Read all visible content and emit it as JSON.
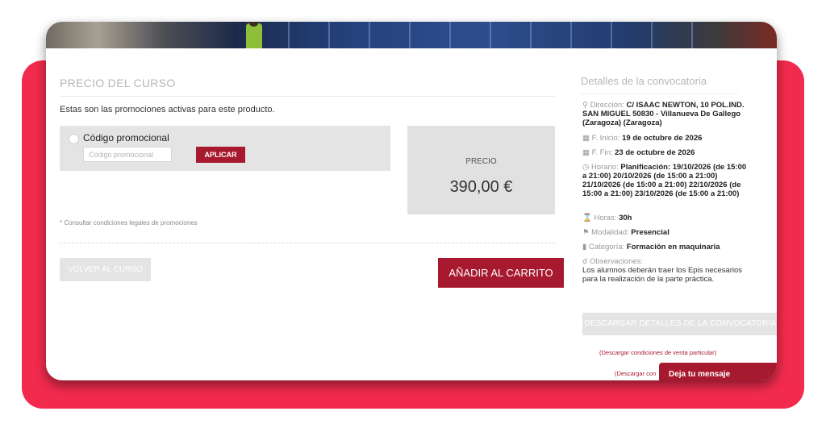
{
  "course": {
    "section_title": "PRECIO DEL CURSO",
    "intro": "Estas son las promociones activas para este producto.",
    "promo_label": "Código promocional",
    "promo_placeholder": "Código promocional",
    "apply_label": "APLICAR",
    "price_label": "PRECIO",
    "price_value": "390,00 €",
    "legal_note": "* Consultar condiciones legales de promociones",
    "back_label": "VOLVER AL CURSO",
    "cart_label": "AÑADIR AL CARRITO"
  },
  "details": {
    "title": "Detalles de la convocatoria",
    "address_key": "Dirección:",
    "address_value": "C/ ISAAC NEWTON, 10 POL.IND. SAN MIGUEL 50830 - Villanueva De Gallego (Zaragoza) (Zaragoza)",
    "start_key": "F. Inicio:",
    "start_value": "19 de octubre de 2026",
    "end_key": "F. Fin:",
    "end_value": "23 de octubre de 2026",
    "schedule_key": "Horario:",
    "schedule_value": "Planificación: 19/10/2026 (de 15:00 a 21:00) 20/10/2026 (de 15:00 a 21:00) 21/10/2026 (de 15:00 a 21:00) 22/10/2026 (de 15:00 a 21:00) 23/10/2026 (de 15:00 a 21:00)",
    "hours_key": "Horas:",
    "hours_value": "30h",
    "modality_key": "Modalidad:",
    "modality_value": "Presencial",
    "category_key": "Categoría:",
    "category_value": "Formación en maquinaria",
    "notes_key": "Observaciones:",
    "notes_value": "Los alumnos deberán traer los Epis necesarios para la realización de la parte práctica.",
    "download_label": "DESCARGAR DETALLES DE LA CONVOCATORIA",
    "sale_conditions_link": "(Descargar condiciones de venta particular)",
    "sale_conditions_link_partial": "(Descargar con"
  },
  "chat": {
    "label": "Deja tu mensaje"
  },
  "colors": {
    "accent": "#a7192e",
    "frame": "#f22b4e",
    "muted_button": "#e4e4e4"
  },
  "icons": [
    "map-pin-icon",
    "calendar-icon",
    "calendar-icon",
    "clock-icon",
    "hourglass-icon",
    "tag-icon",
    "bookmark-icon",
    "search-icon"
  ]
}
